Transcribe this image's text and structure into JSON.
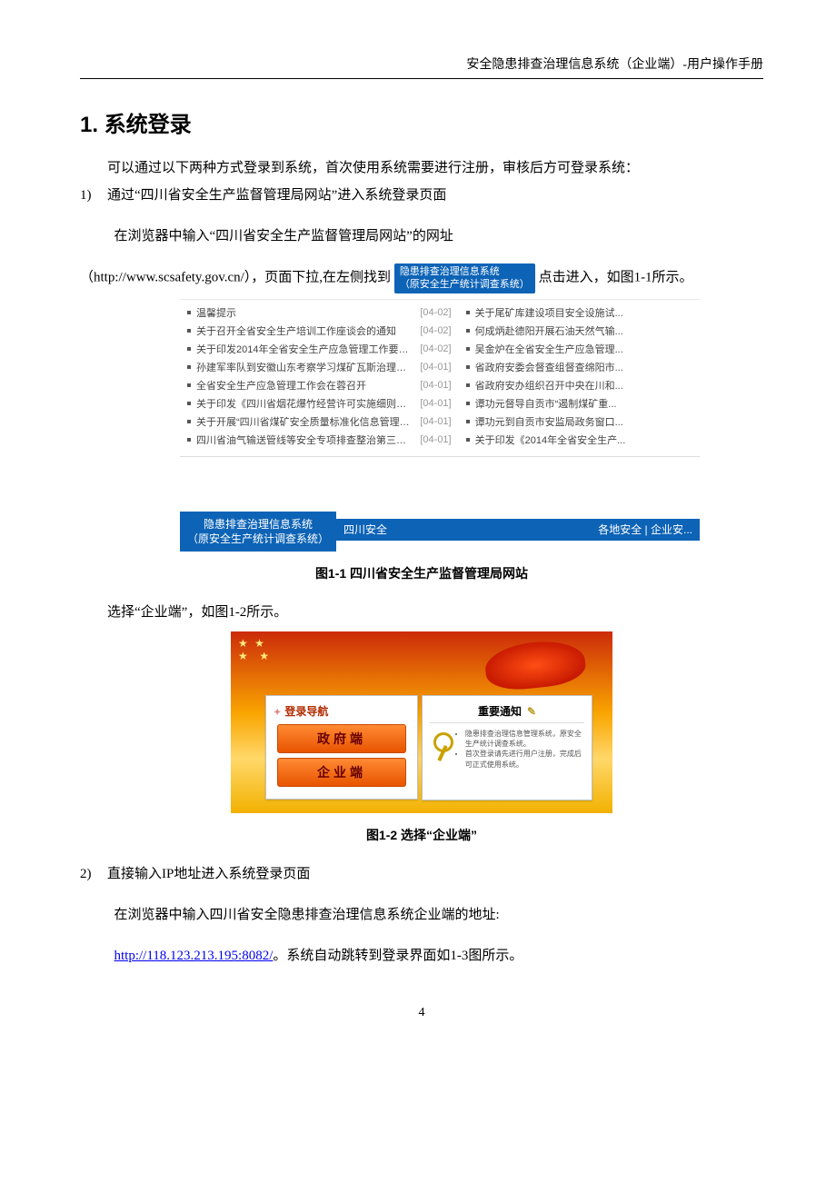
{
  "header": {
    "running_head": "安全隐患排查治理信息系统（企业端）-用户操作手册"
  },
  "section": {
    "number": "1.",
    "title": "系统登录"
  },
  "paragraphs": {
    "intro_1": "可以通过以下两种方式登录到系统，首次使用系统需要进行注册，审核后方可登录系统：",
    "step1_line1_num": "1)",
    "step1_line1": "通过“四川省安全生产监督管理局网站”进入系统登录页面",
    "step1_line2": "在浏览器中输入“四川省安全生产监督管理局网站”的网址",
    "url_line_pre": "（http://www.scsafety.gov.cn/），页面下拉,在左侧找到",
    "badge_line1": "隐患排查治理信息系统",
    "badge_line2": "（原安全生产统计调查系统）",
    "url_line_post": "点击进入，如图1-1所示。",
    "after_fig1": "选择“企业端”，如图1-2所示。",
    "step2_num": "2)",
    "step2_line1": "直接输入IP地址进入系统登录页面",
    "step2_line2": "在浏览器中输入四川省安全隐患排查治理信息系统企业端的地址:",
    "step2_url": "http://118.123.213.195:8082/",
    "step2_line3_rest": "。系统自动跳转到登录界面如1-3图所示。"
  },
  "screenshot1": {
    "left_news": [
      {
        "title": "温馨提示",
        "date": "[04-02]"
      },
      {
        "title": "关于召开全省安全生产培训工作座谈会的通知",
        "date": "[04-02]"
      },
      {
        "title": "关于印发2014年全省安全生产应急管理工作要点的...",
        "date": "[04-02]"
      },
      {
        "title": "孙建军率队到安徽山东考察学习煤矿瓦斯治理工作",
        "date": "[04-01]"
      },
      {
        "title": "全省安全生产应急管理工作会在蓉召开",
        "date": "[04-01]"
      },
      {
        "title": "关于印发《四川省烟花爆竹经营许可实施细则》的...",
        "date": "[04-01]"
      },
      {
        "title": "关于开展“四川省煤矿安全质量标准化信息管理系...",
        "date": "[04-01]"
      },
      {
        "title": "四川省油气输送管线等安全专项排查整治第三督查...",
        "date": "[04-01]"
      }
    ],
    "right_news": [
      {
        "title": "关于尾矿库建设项目安全设施试..."
      },
      {
        "title": "何成炳赴德阳开展石油天然气输..."
      },
      {
        "title": "吴金炉在全省安全生产应急管理..."
      },
      {
        "title": "省政府安委会督查组督查绵阳市..."
      },
      {
        "title": "省政府安办组织召开中央在川和..."
      },
      {
        "title": "谭功元督导自贡市“遏制煤矿重..."
      },
      {
        "title": "谭功元到自贡市安监局政务窗口..."
      },
      {
        "title": "关于印发《2014年全省安全生产..."
      }
    ],
    "blue_badge": {
      "line1": "隐患排查治理信息系统",
      "line2": "（原安全生产统计调查系统）"
    },
    "topbar_left": "四川安全",
    "topbar_right": "各地安全 | 企业安..."
  },
  "fig1_caption": "图1-1 四川省安全生产监督管理局网站",
  "screenshot2": {
    "nav_title": "登录导航",
    "btn_gov": "政府端",
    "btn_ent": "企业端",
    "notice_title": "重要通知",
    "notice_lines": [
      "隐患排查治理信息管理系统，原安全生产统计调查系统。",
      "首次登录请先进行用户注册，完成后可正式使用系统。"
    ]
  },
  "fig2_caption": "图1-2 选择“企业端”",
  "page_number": "4"
}
